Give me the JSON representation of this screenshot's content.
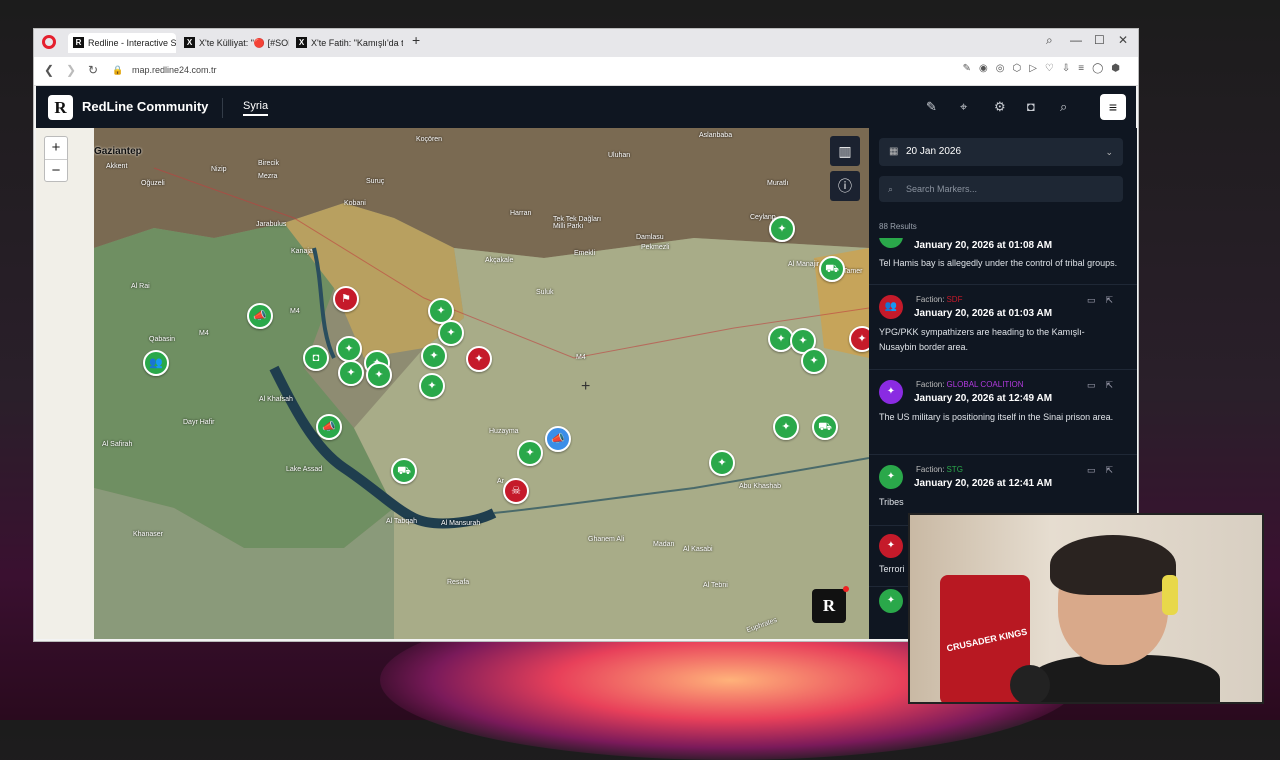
{
  "browser": {
    "tabs": [
      {
        "title": "Redline - Interactive Strate",
        "icon": "R"
      },
      {
        "title": "X'te Külliyat: \"🔴 [#SOND",
        "icon": "X"
      },
      {
        "title": "X'te Fatih: \"Kamışlı'da top",
        "icon": "X"
      }
    ],
    "url": "map.redline24.com.tr"
  },
  "app": {
    "title": "RedLine Community",
    "region_tab": "Syria"
  },
  "map": {
    "zoom_in": "+",
    "zoom_out": "−",
    "r_badge": "R",
    "labels": {
      "gaziantep": "Gaziantep",
      "akkent": "Akkent",
      "oguzeli": "Oğuzeli",
      "nizip": "Nizip",
      "birecik": "Birecik",
      "mezra": "Mezra",
      "suruc": "Suruç",
      "kocoren": "Koçören",
      "uluhan": "Uluhan",
      "aslanbaba": "Aslanbaba",
      "harran": "Harran",
      "tektek": "Tek Tek Dağları Milli Parkı",
      "damlasu": "Damlasu",
      "pekmezli": "Pekmezli",
      "muratli": "Muratlı",
      "ceylanpinar": "Ceylanp",
      "akcakale": "Akçakale",
      "emekli": "Emekli",
      "suluk": "Suluk",
      "jarablus": "Jarabulus",
      "kobani": "Kobani",
      "kanaja": "Kanaja",
      "al_rai": "Al Rai",
      "qabasin": "Qabasin",
      "al_khafsah": "Al Khafsah",
      "dayr_hafir": "Dayr Hafir",
      "al_safirah": "Al Safirah",
      "lake_assad": "Lake Assad",
      "al_tabqah": "Al Tabqah",
      "al_mansurah": "Al Mansurah",
      "khanaser": "Khanaser",
      "resafa": "Resafa",
      "ghanem_ali": "Ghanem Ali",
      "madan": "Madan",
      "al_kasabi": "Al Kasabi",
      "abu_khashab": "Abu Khashab",
      "al_tebni": "Al Tebni",
      "huzayma": "Huzayma",
      "al_manajir": "Al Manajir",
      "tamer": "Tamer",
      "euphrates": "Euphrates",
      "ar": "Ar",
      "m4a": "M4",
      "m4b": "M4",
      "m4c": "M4"
    }
  },
  "sidebar": {
    "date": "20 Jan 2026",
    "search_placeholder": "Search Markers...",
    "results": "88 Results",
    "items": [
      {
        "faction_label": "",
        "faction": "",
        "time": "January 20, 2026 at 01:08 AM",
        "text": "Tel Hamis bay is allegedly under the control of tribal groups."
      },
      {
        "faction_label": "Faction:",
        "faction": "SDF",
        "time": "January 20, 2026 at 01:03 AM",
        "text": "YPG/PKK sympathizers are heading to the Kamışlı-Nusaybin border area."
      },
      {
        "faction_label": "Faction:",
        "faction": "GLOBAL COALITION",
        "time": "January 20, 2026 at 12:49 AM",
        "text": "The US military is positioning itself in the Sinai prison area."
      },
      {
        "faction_label": "Faction:",
        "faction": "STG",
        "time": "January 20, 2026 at 12:41 AM",
        "text": "Tribes"
      },
      {
        "faction_label": "",
        "faction": "",
        "time": "",
        "text": "Terrori"
      }
    ]
  },
  "webcam": {
    "chair_text": "CRUSADER KINGS"
  },
  "colors": {
    "sdf": "#c51a2a",
    "stg": "#2aa84a",
    "coalition": "#8a2be2",
    "app_bg": "#0f1621"
  }
}
